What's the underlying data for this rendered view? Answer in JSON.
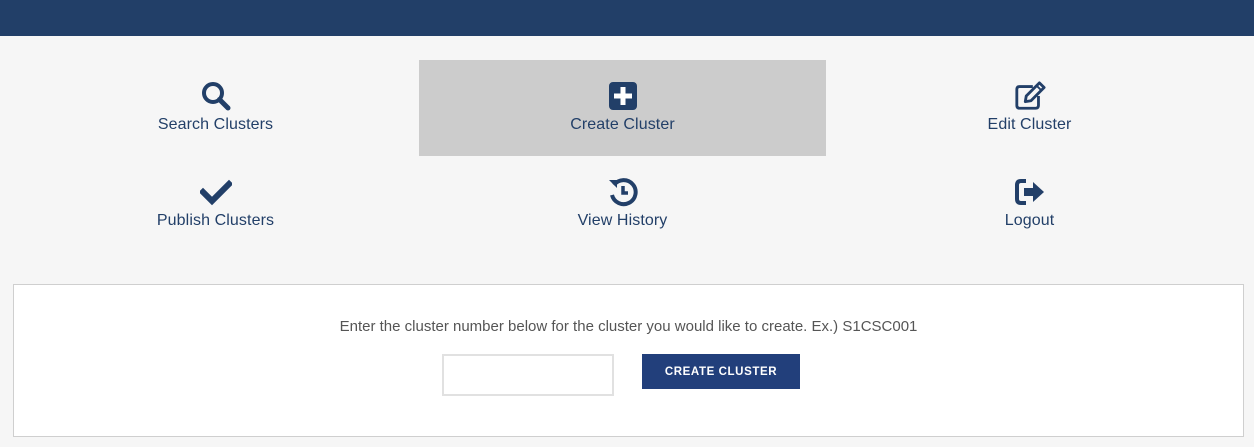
{
  "nav": {
    "items": [
      {
        "label": "Search Clusters",
        "icon": "search-icon"
      },
      {
        "label": "Create Cluster",
        "icon": "plus-square-icon",
        "active": true
      },
      {
        "label": "Edit Cluster",
        "icon": "edit-icon"
      },
      {
        "label": "Publish Clusters",
        "icon": "check-icon"
      },
      {
        "label": "View History",
        "icon": "history-icon"
      },
      {
        "label": "Logout",
        "icon": "logout-icon"
      }
    ]
  },
  "panel": {
    "instruction": "Enter the cluster number below for the cluster you would like to create. Ex.) S1CSC001",
    "input_value": "",
    "input_placeholder": "",
    "button_label": "CREATE CLUSTER"
  },
  "colors": {
    "header": "#223f68",
    "accent": "#223f7b",
    "active_tile": "#cccccc",
    "background": "#f6f6f6"
  }
}
